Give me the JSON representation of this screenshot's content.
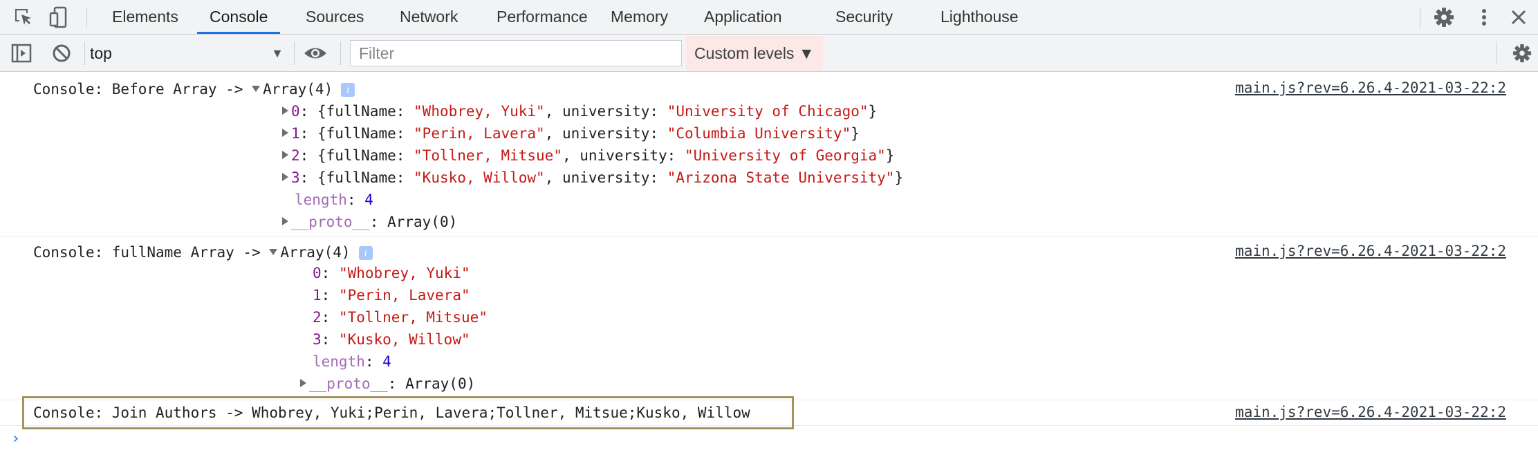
{
  "tabs": [
    {
      "label": "Elements",
      "active": false
    },
    {
      "label": "Console",
      "active": true
    },
    {
      "label": "Sources",
      "active": false
    },
    {
      "label": "Network",
      "active": false
    },
    {
      "label": "Performance",
      "active": false
    },
    {
      "label": "Memory",
      "active": false
    },
    {
      "label": "Application",
      "active": false
    },
    {
      "label": "Security",
      "active": false
    },
    {
      "label": "Lighthouse",
      "active": false
    }
  ],
  "icons": {
    "inspect": "inspect-element-icon",
    "device": "device-toolbar-icon",
    "settings": "gear-icon",
    "menu": "more-vertical-icon",
    "close": "close-icon",
    "sidebar": "sidebar-toggle-icon",
    "clear": "clear-console-icon",
    "eye": "live-expression-eye-icon"
  },
  "toolbar": {
    "context": "top",
    "filter_placeholder": "Filter",
    "custom_levels": "Custom levels ▼"
  },
  "colors": {
    "accent": "#1a73e8",
    "custom_levels_bg": "#fce8e6",
    "highlight_border": "#a39560",
    "string": "#c41a16",
    "number": "#1c00cf",
    "key": "#881391"
  },
  "messages": [
    {
      "prefix": "Console: Before Array -> ",
      "array_label": "Array(4)",
      "info": "i",
      "source": "main.js?rev=6.26.4-2021-03-22:2",
      "items": [
        {
          "index": "0",
          "fullName": "\"Whobrey, Yuki\"",
          "university": "\"University of Chicago\""
        },
        {
          "index": "1",
          "fullName": "\"Perin, Lavera\"",
          "university": "\"Columbia University\""
        },
        {
          "index": "2",
          "fullName": "\"Tollner, Mitsue\"",
          "university": "\"University of Georgia\""
        },
        {
          "index": "3",
          "fullName": "\"Kusko, Willow\"",
          "university": "\"Arizona State University\""
        }
      ],
      "length_key": "length",
      "length_value": "4",
      "proto_key": "__proto__",
      "proto_value": "Array(0)"
    },
    {
      "prefix": "Console: fullName Array -> ",
      "array_label": "Array(4)",
      "info": "i",
      "source": "main.js?rev=6.26.4-2021-03-22:2",
      "items": [
        {
          "index": "0",
          "value": "\"Whobrey, Yuki\""
        },
        {
          "index": "1",
          "value": "\"Perin, Lavera\""
        },
        {
          "index": "2",
          "value": "\"Tollner, Mitsue\""
        },
        {
          "index": "3",
          "value": "\"Kusko, Willow\""
        }
      ],
      "length_key": "length",
      "length_value": "4",
      "proto_key": "__proto__",
      "proto_value": "Array(0)"
    },
    {
      "text": "Console: Join Authors -> Whobrey, Yuki;Perin, Lavera;Tollner, Mitsue;Kusko, Willow",
      "source": "main.js?rev=6.26.4-2021-03-22:2"
    }
  ],
  "prompt": "›"
}
